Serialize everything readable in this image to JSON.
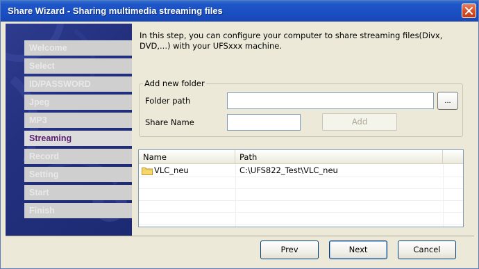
{
  "window": {
    "title": "Share Wizard - Sharing multimedia streaming files"
  },
  "sidebar": {
    "steps": [
      {
        "label": "Welcome",
        "active": false
      },
      {
        "label": "Select",
        "active": false
      },
      {
        "label": "ID/PASSWORD",
        "active": false
      },
      {
        "label": "Jpeg",
        "active": false
      },
      {
        "label": "MP3",
        "active": false
      },
      {
        "label": "Streaming",
        "active": true
      },
      {
        "label": "Record",
        "active": false
      },
      {
        "label": "Setting",
        "active": false
      },
      {
        "label": "Start",
        "active": false
      },
      {
        "label": "Finish",
        "active": false
      }
    ]
  },
  "main": {
    "intro": "In this step, you can configure your computer to share streaming files(Divx, DVD,...) with your UFSxxx machine.",
    "group": {
      "legend": "Add new folder",
      "folder_path_label": "Folder path",
      "folder_path_value": "",
      "browse_label": "...",
      "share_name_label": "Share Name",
      "share_name_value": "",
      "add_label": "Add"
    },
    "list": {
      "columns": [
        "Name",
        "Path"
      ],
      "rows": [
        {
          "name": "VLC_neu",
          "path": "C:\\UFS822_Test\\VLC_neu"
        }
      ]
    }
  },
  "footer": {
    "prev_label": "Prev",
    "next_label": "Next",
    "cancel_label": "Cancel"
  },
  "icons": {
    "close": "close-icon",
    "folder": "folder-icon"
  },
  "colors": {
    "titlebar": "#1e55c7",
    "sidebar": "#23307e",
    "active_step_text": "#5b1f70"
  }
}
